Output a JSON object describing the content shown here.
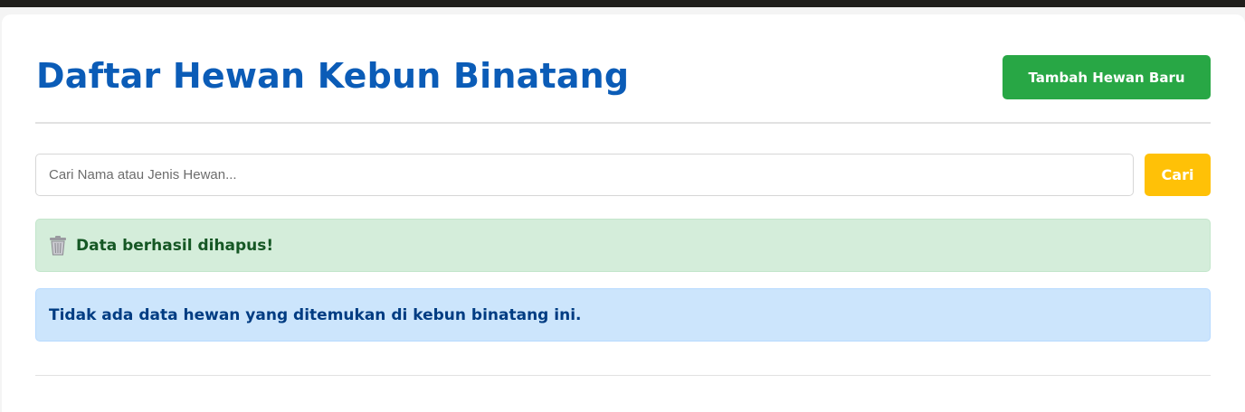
{
  "header": {
    "title": "Daftar Hewan Kebun Binatang",
    "add_button_label": "Tambah Hewan Baru"
  },
  "search": {
    "placeholder": "Cari Nama atau Jenis Hewan...",
    "value": "",
    "button_label": "Cari"
  },
  "alerts": {
    "success": {
      "icon": "trash-icon",
      "message": "Data berhasil dihapus!"
    },
    "info": {
      "message": "Tidak ada data hewan yang ditemukan di kebun binatang ini."
    }
  },
  "colors": {
    "title": "#0b5cb7",
    "add_button": "#28a745",
    "search_button": "#ffc107",
    "success_bg": "#d4edda",
    "success_text": "#155724",
    "info_bg": "#cce5fc",
    "info_text": "#003c82"
  }
}
